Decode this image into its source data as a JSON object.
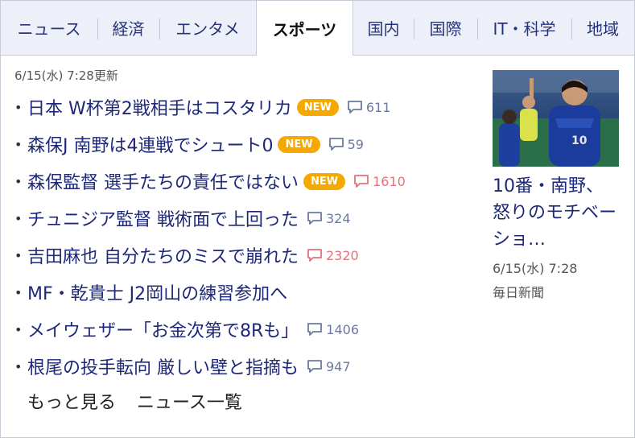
{
  "tabs": [
    {
      "label": "ニュース",
      "active": false
    },
    {
      "label": "経済",
      "active": false
    },
    {
      "label": "エンタメ",
      "active": false
    },
    {
      "label": "スポーツ",
      "active": true
    },
    {
      "label": "国内",
      "active": false
    },
    {
      "label": "国際",
      "active": false
    },
    {
      "label": "IT・科学",
      "active": false
    },
    {
      "label": "地域",
      "active": false
    }
  ],
  "updated": "6/15(水) 7:28更新",
  "news": [
    {
      "title": "日本 W杯第2戦相手はコスタリカ",
      "badge": "NEW",
      "comments": "611",
      "hot": false
    },
    {
      "title": "森保J 南野は4連戦でシュート0",
      "badge": "NEW",
      "comments": "59",
      "hot": false
    },
    {
      "title": "森保監督 選手たちの責任ではない",
      "badge": "NEW",
      "comments": "1610",
      "hot": true
    },
    {
      "title": "チュニジア監督 戦術面で上回った",
      "badge": "",
      "comments": "324",
      "hot": false
    },
    {
      "title": "吉田麻也 自分たちのミスで崩れた",
      "badge": "",
      "comments": "2320",
      "hot": true
    },
    {
      "title": "MF・乾貴士 J2岡山の練習参加へ",
      "badge": "",
      "comments": "",
      "hot": false
    },
    {
      "title": "メイウェザー「お金次第で8Rも」",
      "badge": "",
      "comments": "1406",
      "hot": false
    },
    {
      "title": "根尾の投手転向 厳しい壁と指摘も",
      "badge": "",
      "comments": "947",
      "hot": false
    }
  ],
  "more": {
    "see_more": "もっと見る",
    "news_list": "ニュース一覧"
  },
  "feature": {
    "title": "10番・南野、怒りのモチベーショ…",
    "date": "6/15(水) 7:28",
    "source": "毎日新聞"
  },
  "colors": {
    "link": "#1e2878",
    "badge": "#f5a800",
    "comment": "#6b7a9e",
    "comment_hot": "#e8707a",
    "tab_bg": "#eef0f9"
  },
  "icons": {
    "comment": "speech-bubble-icon"
  }
}
